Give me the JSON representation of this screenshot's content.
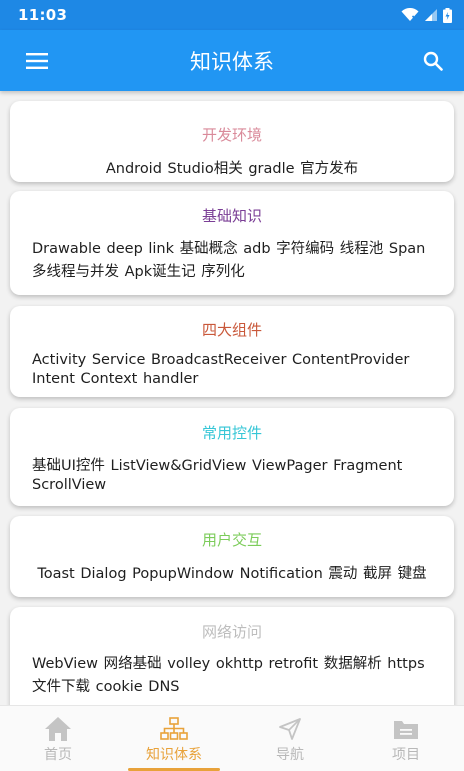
{
  "status_bar": {
    "time": "11:03"
  },
  "app_bar": {
    "title": "知识体系",
    "menu_icon": "menu-icon",
    "search_icon": "search-icon"
  },
  "colors": {
    "primary": "#2196f3",
    "status_bar": "#1e88e5",
    "nav_active": "#e8a23a",
    "nav_inactive": "#b8b8b8"
  },
  "cards": [
    {
      "title": "开发环境",
      "title_color": "#d98a9a",
      "items": "Android Studio相关 gradle 官方发布"
    },
    {
      "title": "基础知识",
      "title_color": "#7b3f96",
      "items": "Drawable deep link 基础概念 adb 字符编码 线程池 Span 多线程与并发 Apk诞生记 序列化"
    },
    {
      "title": "四大组件",
      "title_color": "#c9583a",
      "items": "Activity Service BroadcastReceiver ContentProvider Intent Context handler"
    },
    {
      "title": "常用控件",
      "title_color": "#35c6d6",
      "items": "基础UI控件 ListView&GridView ViewPager Fragment ScrollView"
    },
    {
      "title": "用户交互",
      "title_color": "#7ccc5a",
      "items": "Toast Dialog PopupWindow Notification 震动 截屏 键盘"
    },
    {
      "title": "网络访问",
      "title_color": "#bdbdbd",
      "items": "WebView 网络基础 volley okhttp retrofit 数据解析 https 文件下载 cookie DNS"
    }
  ],
  "bottom_nav": [
    {
      "label": "首页",
      "icon": "home-icon",
      "active": false
    },
    {
      "label": "知识体系",
      "icon": "hierarchy-icon",
      "active": true
    },
    {
      "label": "导航",
      "icon": "navigation-icon",
      "active": false
    },
    {
      "label": "项目",
      "icon": "folder-icon",
      "active": false
    }
  ]
}
